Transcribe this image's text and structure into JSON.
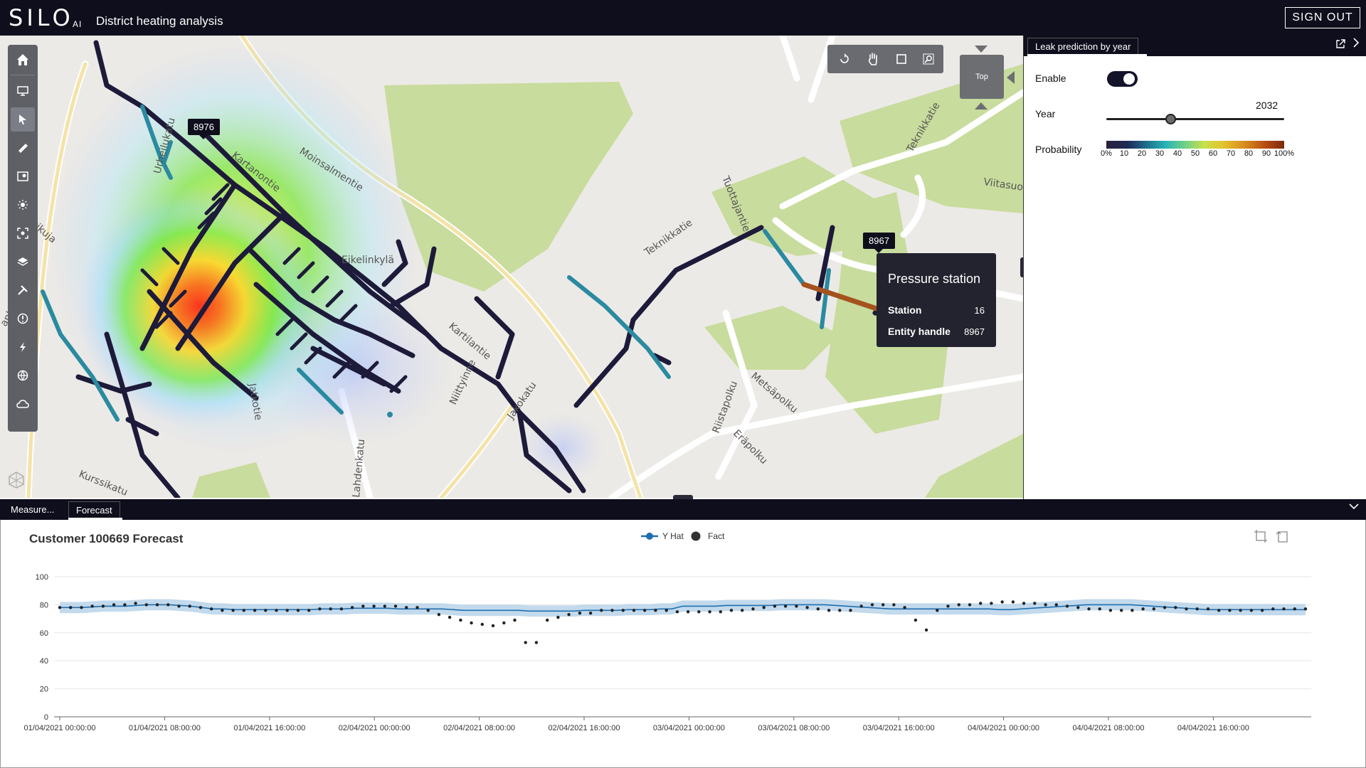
{
  "header": {
    "logo": "SILO",
    "logo_suffix": "AI",
    "title": "District heating analysis",
    "signout_label": "SIGN OUT"
  },
  "map": {
    "street_labels": [
      "Moinsalmentie",
      "Tuottajantie",
      "Teknikkatie",
      "Viitasuo",
      "Teknikkatie",
      "Kartanontie",
      "Eikelinkylä",
      "Kartilantie",
      "Niittyinne",
      "Jakokatu",
      "Metsäpolku",
      "Riistapolku",
      "Eräpolku",
      "Jatkotie",
      "Lahdenkatu",
      "Kurssikatu",
      "Urheilukatu",
      "okkikuja",
      "ankatu"
    ],
    "pin_labels": [
      "8976",
      "8967"
    ],
    "nav_cube_label": "Top",
    "tooltip": {
      "title": "Pressure station",
      "station_key": "Station",
      "station_value": "16",
      "entity_key": "Entity handle",
      "entity_value": "8967"
    },
    "colors": {
      "pipe_dark": "#1d1a3a",
      "pipe_teal": "#2a8aa0",
      "pipe_orange": "#a4521e",
      "park_green": "#c8dc9d",
      "road_yellow": "#f4e3a8"
    }
  },
  "toolbar": {
    "icons": [
      "home-icon",
      "monitor-icon",
      "select-arrow-icon",
      "ruler-icon",
      "map-marker-icon",
      "sun-icon",
      "focus-icon",
      "layers-icon",
      "tools-icon",
      "alert-icon",
      "lightning-icon",
      "globe-icon",
      "cloud-icon"
    ]
  },
  "panel": {
    "tab_label": "Leak prediction by year",
    "enable_label": "Enable",
    "enable_value": true,
    "year_label": "Year",
    "year_value": "2032",
    "probability_label": "Probability",
    "probability_ticks": [
      "0%",
      "10",
      "20",
      "30",
      "40",
      "50",
      "60",
      "70",
      "80",
      "90",
      "100%"
    ]
  },
  "bottom": {
    "tabs": [
      "Measure...",
      "Forecast"
    ],
    "active_tab": "Forecast"
  },
  "chart_data": {
    "type": "line",
    "title": "Customer 100669 Forecast",
    "xlabel": "",
    "ylabel": "",
    "ylim": [
      0,
      100
    ],
    "yticks": [
      0,
      20,
      40,
      60,
      80,
      100
    ],
    "xticks": [
      "01/04/2021 00:00:00",
      "01/04/2021 08:00:00",
      "01/04/2021 16:00:00",
      "02/04/2021 00:00:00",
      "02/04/2021 08:00:00",
      "02/04/2021 16:00:00",
      "03/04/2021 00:00:00",
      "03/04/2021 08:00:00",
      "03/04/2021 16:00:00",
      "04/04/2021 00:00:00",
      "04/04/2021 08:00:00",
      "04/04/2021 16:00:00"
    ],
    "grid": true,
    "legend_position": "top-center",
    "series": [
      {
        "name": "Y Hat",
        "style": "line",
        "color": "#1f6fb0",
        "band_color": "#b9d3ea",
        "values": [
          78,
          78,
          78,
          78.5,
          79,
          79,
          79,
          79.5,
          80,
          80,
          80,
          79.5,
          79,
          78,
          77,
          77,
          76.5,
          76.5,
          76.5,
          76.5,
          76.5,
          76.5,
          76.5,
          76.5,
          77,
          77,
          77,
          77.5,
          77.5,
          77.5,
          77.5,
          77,
          77,
          77,
          77,
          77,
          76.5,
          76,
          76,
          76,
          76,
          76,
          76,
          75.5,
          75.5,
          75.5,
          75.5,
          75.5,
          76,
          76,
          76,
          76,
          76.5,
          76.5,
          76.5,
          77,
          77,
          79,
          79,
          79,
          79,
          79.5,
          79.5,
          79.5,
          79.5,
          79.5,
          80,
          80,
          80,
          80,
          80,
          79.5,
          79,
          78.5,
          78,
          77.5,
          77,
          77,
          77,
          77,
          77,
          77,
          77,
          77,
          77,
          77,
          76.5,
          76.5,
          77,
          77.5,
          78,
          78.5,
          79,
          79.5,
          80,
          80,
          80,
          80,
          80,
          79.5,
          79,
          78.5,
          78,
          77.5,
          77,
          76.5,
          76.5,
          76.5,
          76.5,
          76.5,
          76.5,
          76.5,
          76.5,
          76.5,
          76.5
        ]
      },
      {
        "name": "Fact",
        "style": "scatter",
        "color": "#222222",
        "values": [
          78,
          78,
          78,
          79,
          79,
          80,
          80,
          81,
          80,
          80,
          80,
          79,
          79,
          78,
          77,
          76,
          76,
          76,
          76,
          76,
          76,
          76,
          76,
          76,
          77,
          77,
          77,
          78,
          79,
          79,
          79,
          79,
          78,
          78,
          76,
          73,
          71,
          69,
          67,
          66,
          65,
          67,
          69,
          53,
          53,
          69,
          71,
          73,
          74,
          74,
          76,
          76,
          76,
          76,
          76,
          76,
          76,
          75,
          75,
          75,
          75,
          75,
          76,
          76,
          77,
          78,
          79,
          79,
          79,
          78,
          77,
          76,
          76,
          76,
          79,
          80,
          80,
          80,
          78,
          69,
          62,
          76,
          79,
          80,
          80,
          81,
          81,
          82,
          82,
          81,
          81,
          80,
          80,
          79,
          78,
          77,
          77,
          76,
          76,
          76,
          77,
          77,
          78,
          78,
          77,
          77,
          77,
          76,
          76,
          76,
          76,
          76,
          77,
          77,
          77,
          77
        ]
      }
    ]
  }
}
